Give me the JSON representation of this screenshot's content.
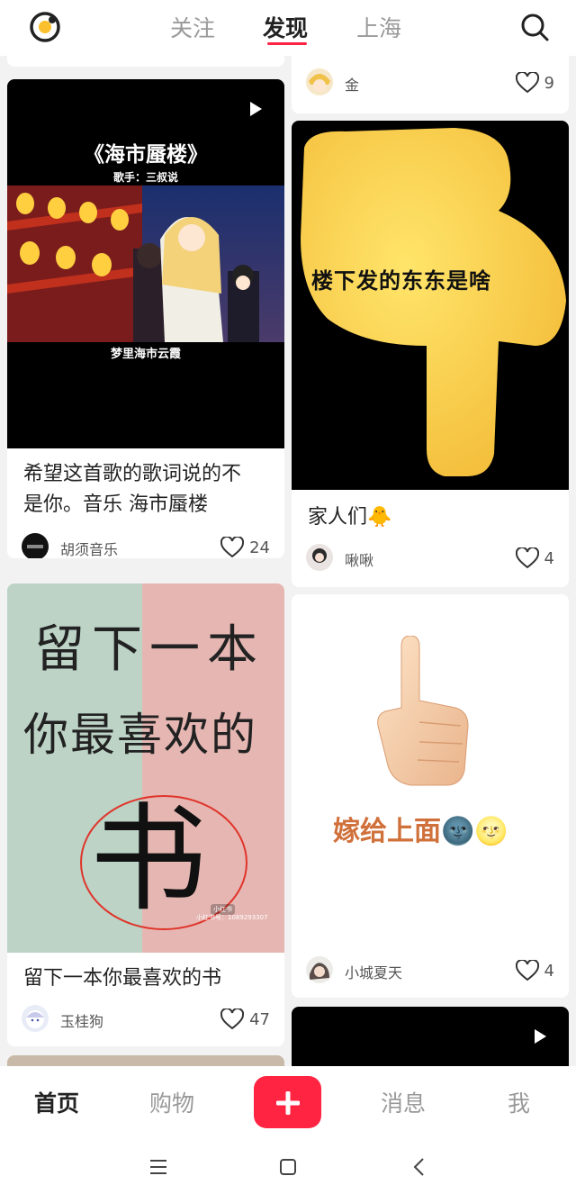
{
  "top_nav": {
    "tabs": [
      "关注",
      "发现",
      "上海"
    ],
    "active_tab": "发现",
    "logo_icon": "app-logo-icon",
    "search_icon": "search-icon"
  },
  "feed": {
    "partial_top_left": {},
    "partial_top_right": {
      "user": "金",
      "likes": "9"
    },
    "cards": [
      {
        "id": "music",
        "image": {
          "title": "《海市蜃楼》",
          "singer": "歌手：三叔说",
          "caption": "梦里海市云霞",
          "type": "video"
        },
        "title_lines": [
          "希望这首歌的歌词说的不",
          "是你。音乐 海市蜃楼"
        ],
        "user": "胡须音乐",
        "likes": "24"
      },
      {
        "id": "hand",
        "image": {
          "text": "楼下发的东东是啥"
        },
        "title_lines": [
          "家人们🐥"
        ],
        "user": "啾啾",
        "likes": "4"
      },
      {
        "id": "book",
        "image": {
          "line1": "留下一本",
          "line2": "你最喜欢的",
          "line3": "书",
          "watermark": "小红书号：1089293307",
          "badge": "小红书"
        },
        "title_lines": [
          "留下一本你最喜欢的书"
        ],
        "user": "玉桂狗",
        "likes": "47"
      },
      {
        "id": "marry",
        "image": {
          "text": "嫁给上面🌚🌝"
        },
        "title_lines": [],
        "user": "小城夏天",
        "likes": "4"
      }
    ]
  },
  "tabbar": {
    "items": [
      "首页",
      "购物",
      "消息",
      "我"
    ],
    "active": "首页",
    "plus_icon": "plus-icon"
  },
  "system_nav": [
    "menu-icon",
    "home-icon",
    "back-icon"
  ],
  "colors": {
    "accent": "#ff2442",
    "text": "#222222",
    "muted": "#999999"
  }
}
